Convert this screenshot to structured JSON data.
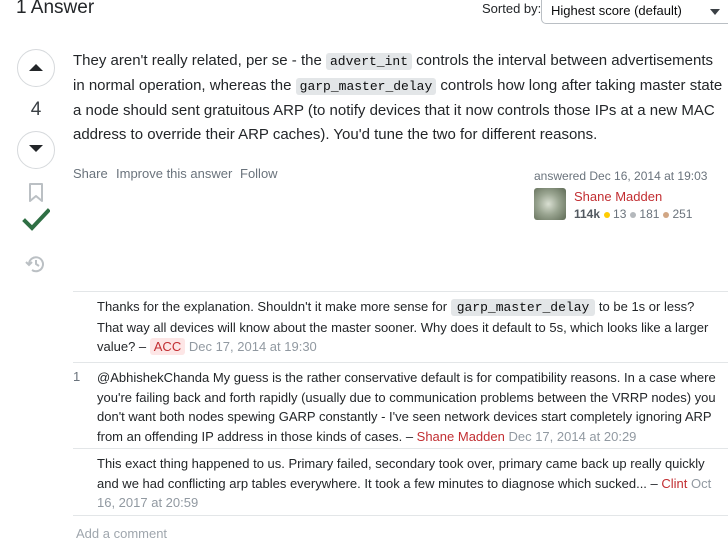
{
  "header": {
    "title": "1 Answer",
    "sorted_by_label": "Sorted by:",
    "sort_value": "Highest score (default)"
  },
  "answer": {
    "score": "4",
    "body": {
      "t1": "They aren't really related, per se - the ",
      "c1": "advert_int",
      "t2": " controls the interval between advertisements in normal operation, whereas the ",
      "c2": "garp_master_delay",
      "t3": " controls how long after taking master state a node should sent gratuitous ARP (to notify devices that it now controls those IPs at a new MAC address to override their ARP caches). You'd tune the two for different reasons."
    },
    "menu": {
      "share": "Share",
      "improve": "Improve this answer",
      "follow": "Follow"
    },
    "answered": "answered Dec 16, 2014 at 19:03",
    "user": {
      "name": "Shane Madden",
      "reputation": "114k",
      "gold": "13",
      "silver": "181",
      "bronze": "251",
      "gold_color": "#ffcc01",
      "silver_color": "#b4b8bc",
      "bronze_color": "#d1a684"
    }
  },
  "icons": {
    "up": "arrow-up-icon",
    "down": "arrow-down-icon",
    "bookmark": "bookmark-icon",
    "accepted": "checkmark-icon",
    "history": "history-icon"
  },
  "colors": {
    "accepted": "#2f6f44",
    "user_link": "#c22e32"
  },
  "comments": [
    {
      "score": "",
      "t1": "Thanks for the explanation. Shouldn't it make more sense for ",
      "code": "garp_master_delay",
      "t2": " to be 1s or less? That way all devices will know about the master sooner. Why does it default to 5s, which looks like a larger value? – ",
      "user": "ACC",
      "date": "Dec 17, 2014 at 19:30"
    },
    {
      "score": "1",
      "text": "@AbhishekChanda My guess is the rather conservative default is for compatibility reasons. In a case where you're failing back and forth rapidly (usually due to communication problems between the VRRP nodes) you don't want both nodes spewing GARP constantly - I've seen network devices start completely ignoring ARP from an offending IP address in those kinds of cases. – ",
      "user": "Shane Madden",
      "date": "Dec 17, 2014 at 20:29"
    },
    {
      "score": "",
      "text": "This exact thing happened to us. Primary failed, secondary took over, primary came back up really quickly and we had conflicting arp tables everywhere. It took a few minutes to diagnose which sucked... – ",
      "user": "Clint",
      "date": "Oct 16, 2017 at 20:59"
    }
  ],
  "add_comment": "Add a comment"
}
